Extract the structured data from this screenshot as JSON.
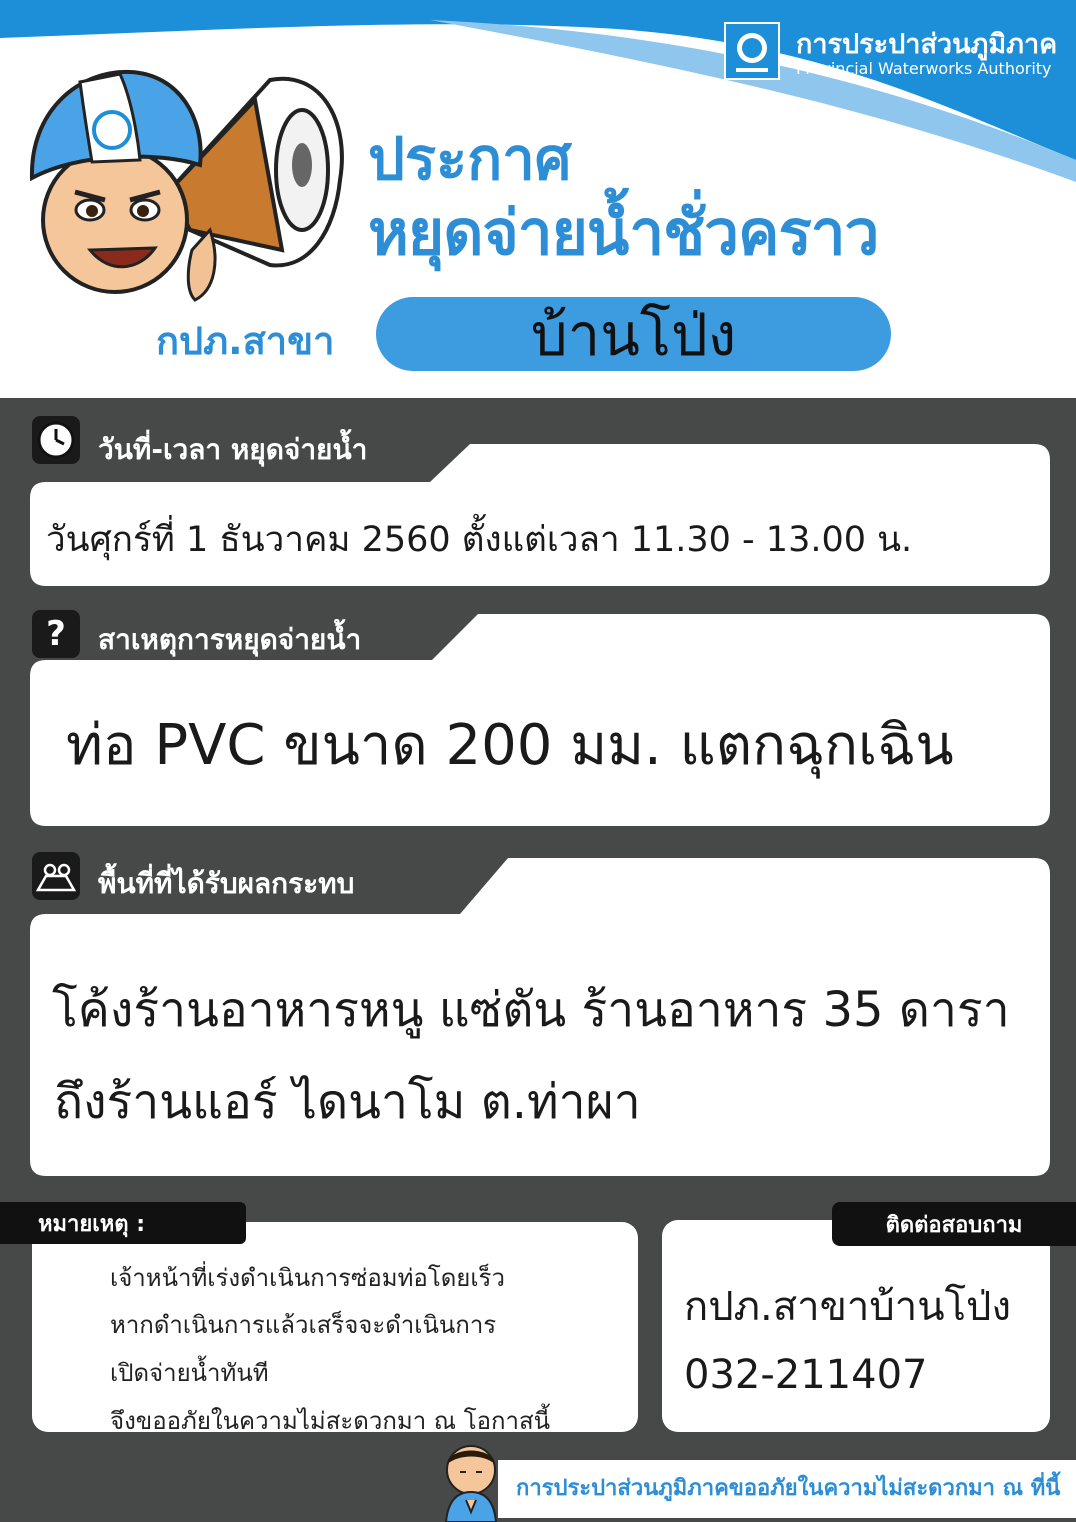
{
  "header": {
    "org_name_th": "การประปาส่วนภูมิภาค",
    "org_name_en": "Provincial Waterworks Authority",
    "title_line1": "ประกาศ",
    "title_line2": "หยุดจ่ายน้ำชั่วคราว",
    "branch_label": "กปภ.สาขา",
    "branch_name": "บ้านโป่ง"
  },
  "sections": {
    "datetime": {
      "title": "วันที่-เวลา หยุดจ่ายน้ำ",
      "value": "วันศุกร์ที่ 1 ธันวาคม 2560 ตั้งแต่เวลา 11.30 - 13.00 น."
    },
    "cause": {
      "title": "สาเหตุการหยุดจ่ายน้ำ",
      "icon_glyph": "?",
      "value": "ท่อ PVC ขนาด 200 มม. แตกฉุกเฉิน"
    },
    "area": {
      "title": "พื้นที่ที่ได้รับผลกระทบ",
      "line1": "โค้งร้านอาหารหนู แซ่ตัน  ร้านอาหาร 35 ดารา",
      "line2": "ถึงร้านแอร์ ไดนาโม ต.ท่าผา"
    }
  },
  "note": {
    "label": "หมายเหตุ :",
    "lines": [
      "เจ้าหน้าที่เร่งดำเนินการซ่อมท่อโดยเร็ว",
      "หากดำเนินการแล้วเสร็จจะดำเนินการ",
      "เปิดจ่ายน้ำทันที",
      "จึงขออภัยในความไม่สะดวกมา ณ โอกาสนี้"
    ]
  },
  "contact": {
    "label": "ติดต่อสอบถาม",
    "name": "กปภ.สาขาบ้านโป่ง",
    "phone": "032-211407"
  },
  "footer": {
    "text": "การประปาส่วนภูมิภาคขออภัยในความไม่สะดวกมา ณ ที่นี้"
  },
  "colors": {
    "brand_blue": "#2d8ed6",
    "panel_gray": "#474948",
    "card_white": "#ffffff"
  },
  "icons": [
    "clock-icon",
    "question-icon",
    "map-pin-icon",
    "megaphone-icon",
    "mascot-icon",
    "pwa-logo-icon"
  ]
}
